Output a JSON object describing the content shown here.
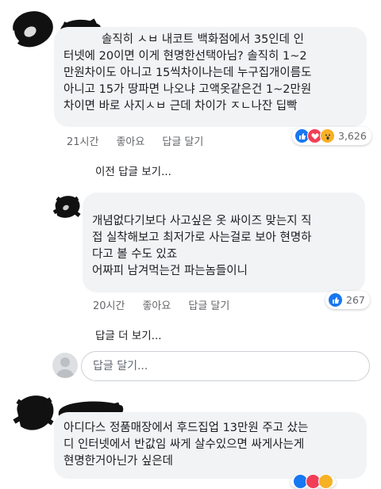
{
  "comments": [
    {
      "text": "솔직히 ㅅㅂ 내코트 백화점에서 35인데 인\n터넷에 20이면 이게 현명한선택아님? 솔직히 1~2\n만원차이도 아니고 15씩차이나는데 누구집개이름도\n아니고 15가 땅파면 나오냐 고액옷같은건 1~2만원\n차이면 바로 사지ㅅㅂ 근데 차이가 ㅈㄴ나잔 딥빡",
      "time": "21시간",
      "like": "좋아요",
      "reply": "답글 달기",
      "reaction_count": "3,626"
    },
    {
      "text": "개념없다기보다 사고싶은 옷 싸이즈 맞는지 직\n접 실착해보고 최저가로 사는걸로 보아 현명하\n다고 볼 수도 있죠\n어짜피 남겨먹는건 파는놈들이니",
      "time": "20시간",
      "like": "좋아요",
      "reply": "답글 달기",
      "reaction_count": "267"
    },
    {
      "text": "아디다스 정품매장에서 후드집업 13만원 주고 샀는\n디 인터넷에서 반값임 싸게 살수있으면 싸게사는게\n현명한거아닌가 싶은데"
    }
  ],
  "prev_replies_link": "이전 답글 보기...",
  "more_replies_link": "답글 더 보기...",
  "reply_placeholder": "답글 달기...",
  "colors": {
    "like_blue": "#1877f2",
    "love_red": "#f33e58",
    "wow_yellow": "#f7b125",
    "bubble_bg": "#f2f3f5"
  }
}
